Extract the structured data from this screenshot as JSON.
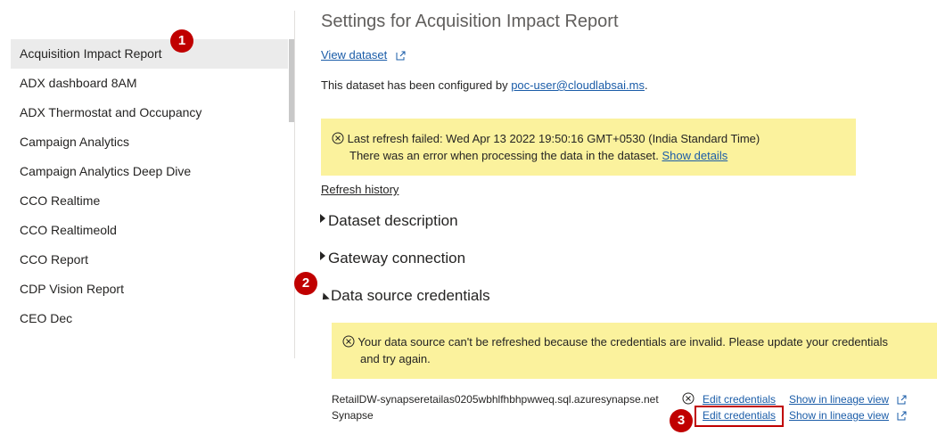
{
  "sidebar": {
    "items": [
      {
        "label": "Acquisition Impact Report"
      },
      {
        "label": "ADX dashboard 8AM"
      },
      {
        "label": "ADX Thermostat and Occupancy"
      },
      {
        "label": "Campaign Analytics"
      },
      {
        "label": "Campaign Analytics Deep Dive"
      },
      {
        "label": "CCO Realtime"
      },
      {
        "label": "CCO Realtimeold"
      },
      {
        "label": "CCO Report"
      },
      {
        "label": "CDP Vision Report"
      },
      {
        "label": "CEO Dec"
      }
    ],
    "selected_index": 0
  },
  "badges": [
    "1",
    "2",
    "3"
  ],
  "main": {
    "title": "Settings for Acquisition Impact Report",
    "view_dataset": "View dataset",
    "configured_prefix": "This dataset has been configured by ",
    "configured_user": "poc-user@cloudlabsai.ms",
    "configured_suffix": ".",
    "refresh_error": {
      "line1": "Last refresh failed: Wed Apr 13 2022 19:50:16 GMT+0530 (India Standard Time)",
      "line2": "There was an error when processing the data in the dataset.",
      "show_details": "Show details"
    },
    "refresh_history": "Refresh history",
    "sections": {
      "dataset_description": "Dataset description",
      "gateway_connection": "Gateway connection",
      "data_source_credentials": "Data source credentials"
    },
    "credentials_warning": {
      "line1": "Your data source can't be refreshed because the credentials are invalid. Please update your credentials",
      "line2": "and try again."
    },
    "sources": [
      {
        "name": "RetailDW-synapseretailas0205wbhlfhbhpwweq.sql.azuresynapse.net",
        "edit": "Edit credentials",
        "lineage": "Show in lineage view",
        "error": true
      },
      {
        "name": "Synapse",
        "edit": "Edit credentials",
        "lineage": "Show in lineage view",
        "error": false
      }
    ]
  },
  "colors": {
    "link": "#1a5ca8",
    "warning_bg": "#fbf29d",
    "badge": "#c00000",
    "selected_bg": "#ebebeb"
  }
}
